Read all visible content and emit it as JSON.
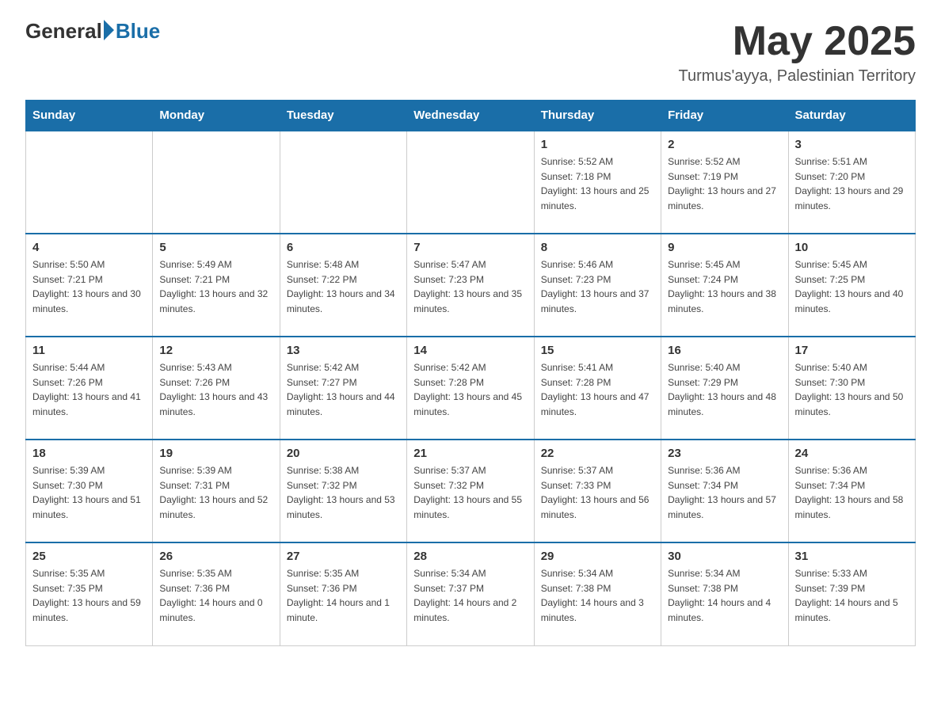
{
  "header": {
    "logo_general": "General",
    "logo_blue": "Blue",
    "month_year": "May 2025",
    "location": "Turmus'ayya, Palestinian Territory"
  },
  "weekdays": [
    "Sunday",
    "Monday",
    "Tuesday",
    "Wednesday",
    "Thursday",
    "Friday",
    "Saturday"
  ],
  "weeks": [
    [
      {
        "day": "",
        "info": ""
      },
      {
        "day": "",
        "info": ""
      },
      {
        "day": "",
        "info": ""
      },
      {
        "day": "",
        "info": ""
      },
      {
        "day": "1",
        "info": "Sunrise: 5:52 AM\nSunset: 7:18 PM\nDaylight: 13 hours and 25 minutes."
      },
      {
        "day": "2",
        "info": "Sunrise: 5:52 AM\nSunset: 7:19 PM\nDaylight: 13 hours and 27 minutes."
      },
      {
        "day": "3",
        "info": "Sunrise: 5:51 AM\nSunset: 7:20 PM\nDaylight: 13 hours and 29 minutes."
      }
    ],
    [
      {
        "day": "4",
        "info": "Sunrise: 5:50 AM\nSunset: 7:21 PM\nDaylight: 13 hours and 30 minutes."
      },
      {
        "day": "5",
        "info": "Sunrise: 5:49 AM\nSunset: 7:21 PM\nDaylight: 13 hours and 32 minutes."
      },
      {
        "day": "6",
        "info": "Sunrise: 5:48 AM\nSunset: 7:22 PM\nDaylight: 13 hours and 34 minutes."
      },
      {
        "day": "7",
        "info": "Sunrise: 5:47 AM\nSunset: 7:23 PM\nDaylight: 13 hours and 35 minutes."
      },
      {
        "day": "8",
        "info": "Sunrise: 5:46 AM\nSunset: 7:23 PM\nDaylight: 13 hours and 37 minutes."
      },
      {
        "day": "9",
        "info": "Sunrise: 5:45 AM\nSunset: 7:24 PM\nDaylight: 13 hours and 38 minutes."
      },
      {
        "day": "10",
        "info": "Sunrise: 5:45 AM\nSunset: 7:25 PM\nDaylight: 13 hours and 40 minutes."
      }
    ],
    [
      {
        "day": "11",
        "info": "Sunrise: 5:44 AM\nSunset: 7:26 PM\nDaylight: 13 hours and 41 minutes."
      },
      {
        "day": "12",
        "info": "Sunrise: 5:43 AM\nSunset: 7:26 PM\nDaylight: 13 hours and 43 minutes."
      },
      {
        "day": "13",
        "info": "Sunrise: 5:42 AM\nSunset: 7:27 PM\nDaylight: 13 hours and 44 minutes."
      },
      {
        "day": "14",
        "info": "Sunrise: 5:42 AM\nSunset: 7:28 PM\nDaylight: 13 hours and 45 minutes."
      },
      {
        "day": "15",
        "info": "Sunrise: 5:41 AM\nSunset: 7:28 PM\nDaylight: 13 hours and 47 minutes."
      },
      {
        "day": "16",
        "info": "Sunrise: 5:40 AM\nSunset: 7:29 PM\nDaylight: 13 hours and 48 minutes."
      },
      {
        "day": "17",
        "info": "Sunrise: 5:40 AM\nSunset: 7:30 PM\nDaylight: 13 hours and 50 minutes."
      }
    ],
    [
      {
        "day": "18",
        "info": "Sunrise: 5:39 AM\nSunset: 7:30 PM\nDaylight: 13 hours and 51 minutes."
      },
      {
        "day": "19",
        "info": "Sunrise: 5:39 AM\nSunset: 7:31 PM\nDaylight: 13 hours and 52 minutes."
      },
      {
        "day": "20",
        "info": "Sunrise: 5:38 AM\nSunset: 7:32 PM\nDaylight: 13 hours and 53 minutes."
      },
      {
        "day": "21",
        "info": "Sunrise: 5:37 AM\nSunset: 7:32 PM\nDaylight: 13 hours and 55 minutes."
      },
      {
        "day": "22",
        "info": "Sunrise: 5:37 AM\nSunset: 7:33 PM\nDaylight: 13 hours and 56 minutes."
      },
      {
        "day": "23",
        "info": "Sunrise: 5:36 AM\nSunset: 7:34 PM\nDaylight: 13 hours and 57 minutes."
      },
      {
        "day": "24",
        "info": "Sunrise: 5:36 AM\nSunset: 7:34 PM\nDaylight: 13 hours and 58 minutes."
      }
    ],
    [
      {
        "day": "25",
        "info": "Sunrise: 5:35 AM\nSunset: 7:35 PM\nDaylight: 13 hours and 59 minutes."
      },
      {
        "day": "26",
        "info": "Sunrise: 5:35 AM\nSunset: 7:36 PM\nDaylight: 14 hours and 0 minutes."
      },
      {
        "day": "27",
        "info": "Sunrise: 5:35 AM\nSunset: 7:36 PM\nDaylight: 14 hours and 1 minute."
      },
      {
        "day": "28",
        "info": "Sunrise: 5:34 AM\nSunset: 7:37 PM\nDaylight: 14 hours and 2 minutes."
      },
      {
        "day": "29",
        "info": "Sunrise: 5:34 AM\nSunset: 7:38 PM\nDaylight: 14 hours and 3 minutes."
      },
      {
        "day": "30",
        "info": "Sunrise: 5:34 AM\nSunset: 7:38 PM\nDaylight: 14 hours and 4 minutes."
      },
      {
        "day": "31",
        "info": "Sunrise: 5:33 AM\nSunset: 7:39 PM\nDaylight: 14 hours and 5 minutes."
      }
    ]
  ]
}
